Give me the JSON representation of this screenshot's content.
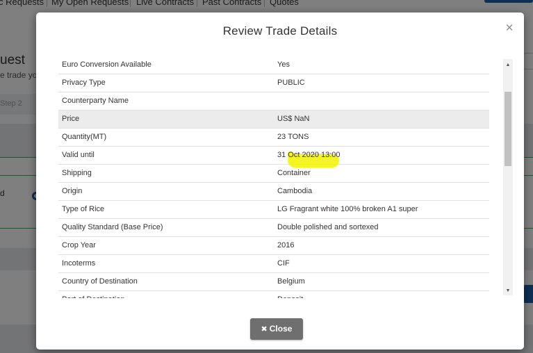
{
  "background": {
    "nav_items": [
      "c Requests",
      "My Open Requests",
      "Live Contracts",
      "Past Contracts",
      "Quotes"
    ],
    "page_title": "uest",
    "page_subtitle": "e trade yo",
    "step_label": "Step 2",
    "side_letter": "d"
  },
  "modal": {
    "title": "Review Trade Details",
    "close_icon": "×",
    "close_button_label": "Close",
    "close_button_icon": "✖",
    "rows": [
      {
        "label": "Euro Conversion Available",
        "value": "Yes"
      },
      {
        "label": "Privacy Type",
        "value": "PUBLIC"
      },
      {
        "label": "Counterparty Name",
        "value": ""
      },
      {
        "label": "Price",
        "value": "US$ NaN"
      },
      {
        "label": "Quantity(MT)",
        "value": "23 TONS"
      },
      {
        "label": "Valid until",
        "value": "31 Oct 2020 13:00"
      },
      {
        "label": "Shipping",
        "value": "Container"
      },
      {
        "label": "Origin",
        "value": "Cambodia"
      },
      {
        "label": "Type of Rice",
        "value": "LG Fragrant white 100% broken A1 super"
      },
      {
        "label": "Quality Standard (Base Price)",
        "value": "Double polished and sortexed"
      },
      {
        "label": "Crop Year",
        "value": "2016"
      },
      {
        "label": "Incoterms",
        "value": "CIF"
      },
      {
        "label": "Country of Destination",
        "value": "Belgium"
      },
      {
        "label": "Port of Destination",
        "value": "Deposit"
      }
    ],
    "highlighted_row": "Price",
    "colors": {
      "highlight": "#f2f200",
      "close_button": "#6f6f6f",
      "overlay": "rgba(0,0,0,0.5)"
    }
  }
}
